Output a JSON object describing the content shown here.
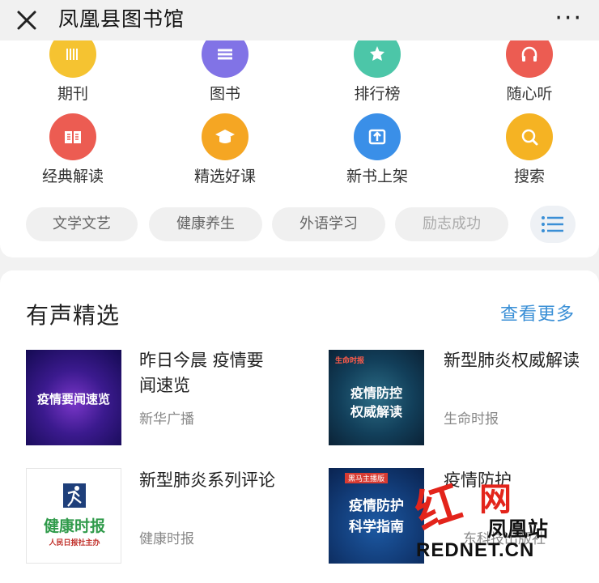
{
  "header": {
    "title": "凤凰县图书馆",
    "more": "···"
  },
  "shortcuts": [
    {
      "label": "期刊",
      "icon": "periodical-icon",
      "color": "#f5c331"
    },
    {
      "label": "图书",
      "icon": "books-icon",
      "color": "#8173e6"
    },
    {
      "label": "排行榜",
      "icon": "ranking-star-icon",
      "color": "#4cc6a8"
    },
    {
      "label": "随心听",
      "icon": "headphones-icon",
      "color": "#ec5c52"
    },
    {
      "label": "经典解读",
      "icon": "open-book-icon",
      "color": "#ec5c52"
    },
    {
      "label": "精选好课",
      "icon": "graduation-cap-icon",
      "color": "#f5a623"
    },
    {
      "label": "新书上架",
      "icon": "upload-icon",
      "color": "#3a8fe8"
    },
    {
      "label": "搜索",
      "icon": "search-icon",
      "color": "#f5b323"
    }
  ],
  "categories": [
    "文学文艺",
    "健康养生",
    "外语学习",
    "励志成功"
  ],
  "category_menu_icon": "list-icon",
  "audio_section": {
    "title": "有声精选",
    "see_more": "查看更多",
    "items": [
      {
        "title": "昨日今晨 疫情要闻速览",
        "author": "新华广播",
        "cover_text": "疫情要闻速览"
      },
      {
        "title": "新型肺炎权威解读",
        "author": "生命时报",
        "cover_top": "生命时报",
        "cover_line1": "疫情防控",
        "cover_line2": "权威解读"
      },
      {
        "title": "新型肺炎系列评论",
        "author": "健康时报",
        "cover_brand": "健康时报",
        "cover_sub": "人民日报社主办"
      },
      {
        "title": "疫情防护",
        "author": "东科技出版社",
        "cover_top": "黑马主播版",
        "cover_line1": "疫情防护",
        "cover_line2": "科学指南"
      }
    ]
  },
  "watermark": {
    "hong": "红",
    "net": "网",
    "station": "凤凰站",
    "url": "REDNET.CN"
  }
}
